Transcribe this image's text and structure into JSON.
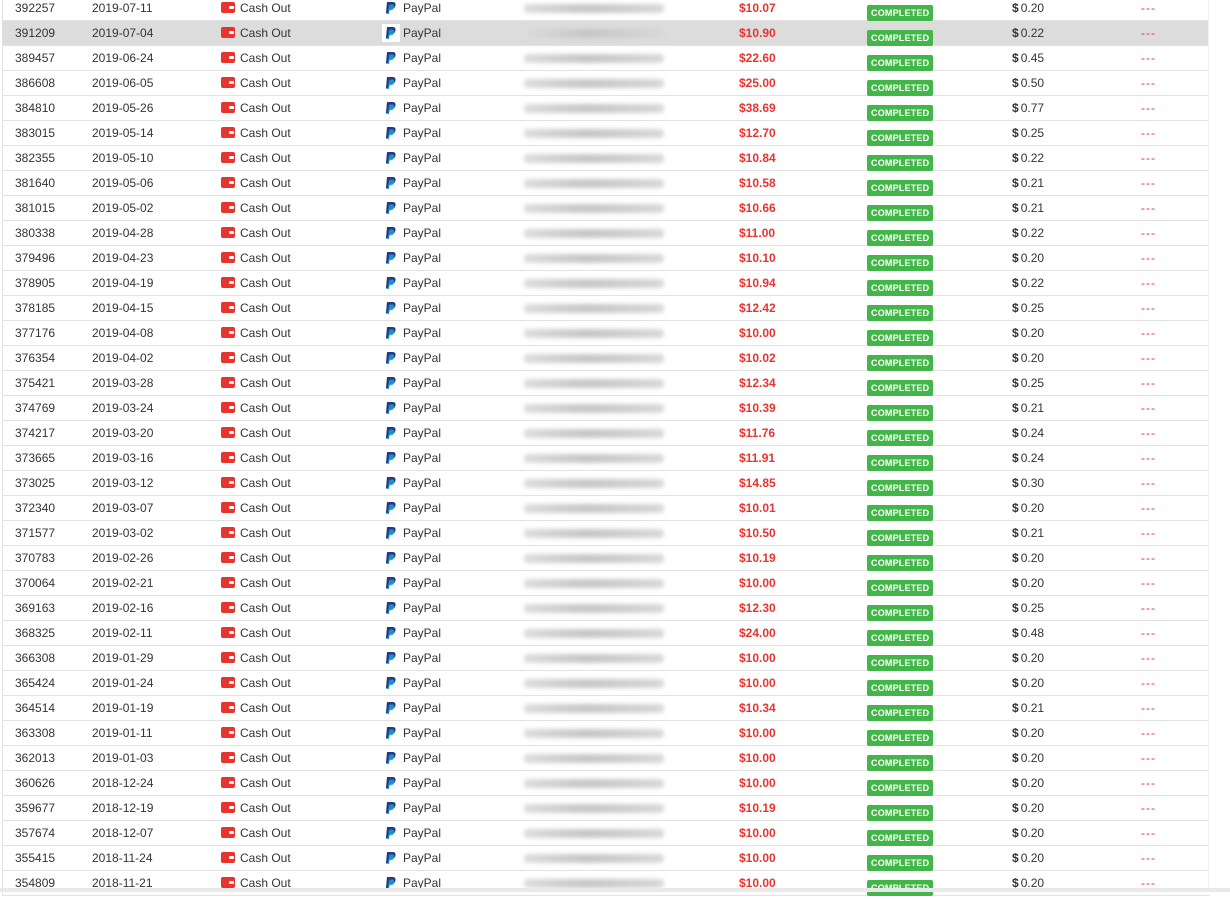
{
  "type_label": "Cash Out",
  "method_label": "PayPal",
  "status_label": "COMPLETED",
  "action_label": "---",
  "currency": "$",
  "highlighted_index": 1,
  "rows": [
    {
      "id": "392257",
      "date": "2019-07-11",
      "amount": "$10.07",
      "fee": "0.20"
    },
    {
      "id": "391209",
      "date": "2019-07-04",
      "amount": "$10.90",
      "fee": "0.22"
    },
    {
      "id": "389457",
      "date": "2019-06-24",
      "amount": "$22.60",
      "fee": "0.45"
    },
    {
      "id": "386608",
      "date": "2019-06-05",
      "amount": "$25.00",
      "fee": "0.50"
    },
    {
      "id": "384810",
      "date": "2019-05-26",
      "amount": "$38.69",
      "fee": "0.77"
    },
    {
      "id": "383015",
      "date": "2019-05-14",
      "amount": "$12.70",
      "fee": "0.25"
    },
    {
      "id": "382355",
      "date": "2019-05-10",
      "amount": "$10.84",
      "fee": "0.22"
    },
    {
      "id": "381640",
      "date": "2019-05-06",
      "amount": "$10.58",
      "fee": "0.21"
    },
    {
      "id": "381015",
      "date": "2019-05-02",
      "amount": "$10.66",
      "fee": "0.21"
    },
    {
      "id": "380338",
      "date": "2019-04-28",
      "amount": "$11.00",
      "fee": "0.22"
    },
    {
      "id": "379496",
      "date": "2019-04-23",
      "amount": "$10.10",
      "fee": "0.20"
    },
    {
      "id": "378905",
      "date": "2019-04-19",
      "amount": "$10.94",
      "fee": "0.22"
    },
    {
      "id": "378185",
      "date": "2019-04-15",
      "amount": "$12.42",
      "fee": "0.25"
    },
    {
      "id": "377176",
      "date": "2019-04-08",
      "amount": "$10.00",
      "fee": "0.20"
    },
    {
      "id": "376354",
      "date": "2019-04-02",
      "amount": "$10.02",
      "fee": "0.20"
    },
    {
      "id": "375421",
      "date": "2019-03-28",
      "amount": "$12.34",
      "fee": "0.25"
    },
    {
      "id": "374769",
      "date": "2019-03-24",
      "amount": "$10.39",
      "fee": "0.21"
    },
    {
      "id": "374217",
      "date": "2019-03-20",
      "amount": "$11.76",
      "fee": "0.24"
    },
    {
      "id": "373665",
      "date": "2019-03-16",
      "amount": "$11.91",
      "fee": "0.24"
    },
    {
      "id": "373025",
      "date": "2019-03-12",
      "amount": "$14.85",
      "fee": "0.30"
    },
    {
      "id": "372340",
      "date": "2019-03-07",
      "amount": "$10.01",
      "fee": "0.20"
    },
    {
      "id": "371577",
      "date": "2019-03-02",
      "amount": "$10.50",
      "fee": "0.21"
    },
    {
      "id": "370783",
      "date": "2019-02-26",
      "amount": "$10.19",
      "fee": "0.20"
    },
    {
      "id": "370064",
      "date": "2019-02-21",
      "amount": "$10.00",
      "fee": "0.20"
    },
    {
      "id": "369163",
      "date": "2019-02-16",
      "amount": "$12.30",
      "fee": "0.25"
    },
    {
      "id": "368325",
      "date": "2019-02-11",
      "amount": "$24.00",
      "fee": "0.48"
    },
    {
      "id": "366308",
      "date": "2019-01-29",
      "amount": "$10.00",
      "fee": "0.20"
    },
    {
      "id": "365424",
      "date": "2019-01-24",
      "amount": "$10.00",
      "fee": "0.20"
    },
    {
      "id": "364514",
      "date": "2019-01-19",
      "amount": "$10.34",
      "fee": "0.21"
    },
    {
      "id": "363308",
      "date": "2019-01-11",
      "amount": "$10.00",
      "fee": "0.20"
    },
    {
      "id": "362013",
      "date": "2019-01-03",
      "amount": "$10.00",
      "fee": "0.20"
    },
    {
      "id": "360626",
      "date": "2018-12-24",
      "amount": "$10.00",
      "fee": "0.20"
    },
    {
      "id": "359677",
      "date": "2018-12-19",
      "amount": "$10.19",
      "fee": "0.20"
    },
    {
      "id": "357674",
      "date": "2018-12-07",
      "amount": "$10.00",
      "fee": "0.20"
    },
    {
      "id": "355415",
      "date": "2018-11-24",
      "amount": "$10.00",
      "fee": "0.20"
    },
    {
      "id": "354809",
      "date": "2018-11-21",
      "amount": "$10.00",
      "fee": "0.20"
    }
  ]
}
